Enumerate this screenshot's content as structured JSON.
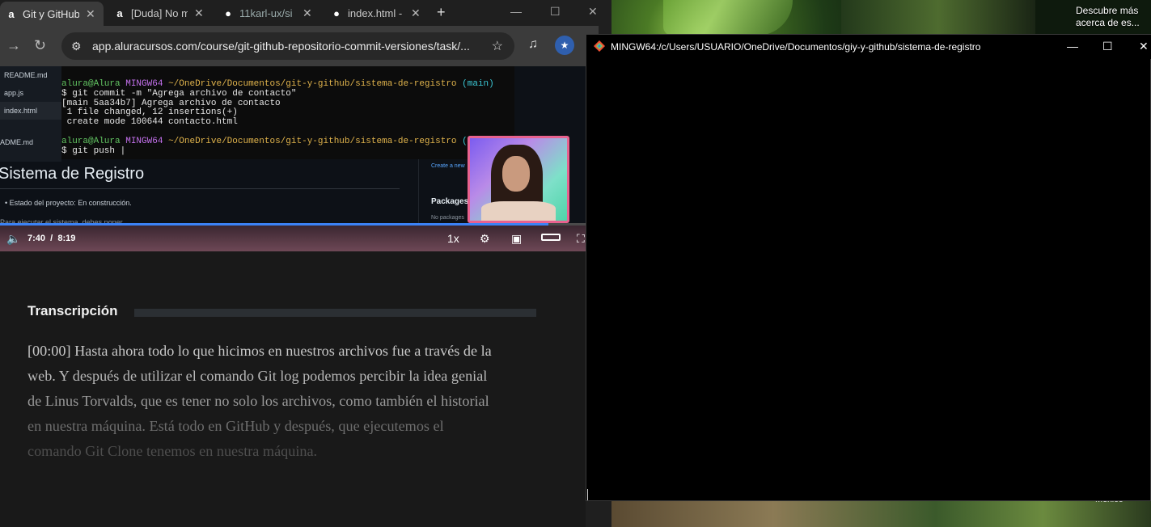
{
  "browser": {
    "tabs": [
      {
        "label": "Git y GitHub",
        "icon": "alura-icon",
        "active": true
      },
      {
        "label": "[Duda] No m",
        "icon": "alura-icon",
        "active": false
      },
      {
        "label": "11karl-ux/si",
        "icon": "github-icon",
        "active": false
      },
      {
        "label": "index.html -",
        "icon": "github-icon",
        "active": false
      }
    ],
    "new_tab_symbol": "+",
    "url": "app.aluracursos.com/course/git-github-repositorio-commit-versiones/task/...",
    "avatar_label": "★"
  },
  "video": {
    "files": [
      "README.md",
      "app.js",
      "index.html"
    ],
    "terminal": {
      "user": "alura@Alura",
      "host": "MINGW64",
      "path": "~/OneDrive/Documentos/git-y-github/sistema-de-registro",
      "branch": "(main)",
      "branch_cut": "(m",
      "cmd1": "$ git commit -m \"Agrega archivo de contacto\"",
      "out1": "[main 5aa34b7] Agrega archivo de contacto",
      "out2": " 1 file changed, 12 insertions(+)",
      "out3": " create mode 100644 contacto.html",
      "cmd2": "$ git push |"
    },
    "github": {
      "readme_label": "ADME.md",
      "title": "Sistema de Registro",
      "bullet": "Estado del proyecto: En construcción.",
      "partial_line": "Para ejecutar el sistema, debes poner",
      "create_link": "Create a new",
      "packages": "Packages",
      "no_packages": "No packages"
    },
    "time_current": "7:40",
    "time_separator": "/",
    "time_total": "8:19",
    "progress_fraction": 0.9365,
    "speed": "1x"
  },
  "transcript": {
    "heading": "Transcripción",
    "lines": [
      "[00:00] Hasta ahora todo lo que hicimos en nuestros archivos fue a través de la",
      "web. Y después de utilizar el comando Git log podemos percibir la idea genial",
      "de Linus Torvalds, que es tener no solo los archivos, como también el historial",
      "en nuestra máquina. Está todo en GitHub y después, que ejecutemos el",
      "comando Git Clone tenemos en nuestra máquina."
    ]
  },
  "bash": {
    "title": "MINGW64:/c/Users/USUARIO/OneDrive/Documentos/giy-y-github/sistema-de-registro"
  },
  "desktop": {
    "spotlight_line1": "Descubre más",
    "spotlight_line2": "acerca de es...",
    "bottom_label": "México"
  }
}
